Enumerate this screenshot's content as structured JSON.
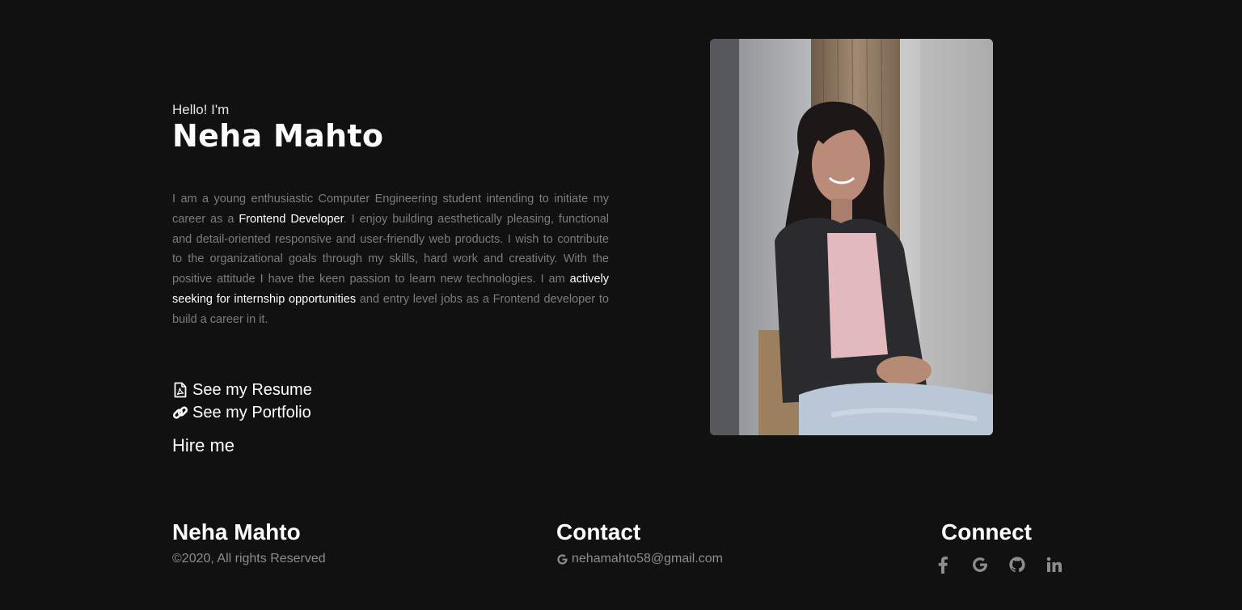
{
  "hero": {
    "greeting": "Hello! I'm",
    "name": "Neha Mahto",
    "bio": {
      "p1": "I am a young enthusiastic Computer Engineering student intending to initiate my career as a ",
      "h1": "Frontend Developer",
      "p2": ". I enjoy building aesthetically pleasing, functional and detail-oriented responsive and user-friendly web products. I wish to contribute to the organizational goals through my skills, hard work and creativity. With the positive attitude I have the keen passion to learn new technologies. I am ",
      "h2": "actively seeking for internship opportunities",
      "p3": " and entry level jobs as a Frontend developer to build a career in it."
    },
    "links": {
      "resume_label": "See my Resume",
      "resume_icon": "file-pdf-icon",
      "portfolio_label": "See my Portfolio",
      "portfolio_icon": "link-icon"
    },
    "hire_label": "Hire me",
    "photo": "profile-photo"
  },
  "footer": {
    "name_title": "Neha Mahto",
    "copyright": "©2020, All rights Reserved",
    "contact_title": "Contact",
    "contact_icon": "google-icon",
    "email": "nehamahto58@gmail.com",
    "connect_title": "Connect",
    "social_icons": [
      "facebook-icon",
      "google-icon",
      "github-icon",
      "linkedin-icon"
    ]
  },
  "colors": {
    "background": "#111111",
    "text": "#ffffff",
    "muted": "#7c7c7c",
    "icon_muted": "#8d8d8d"
  }
}
